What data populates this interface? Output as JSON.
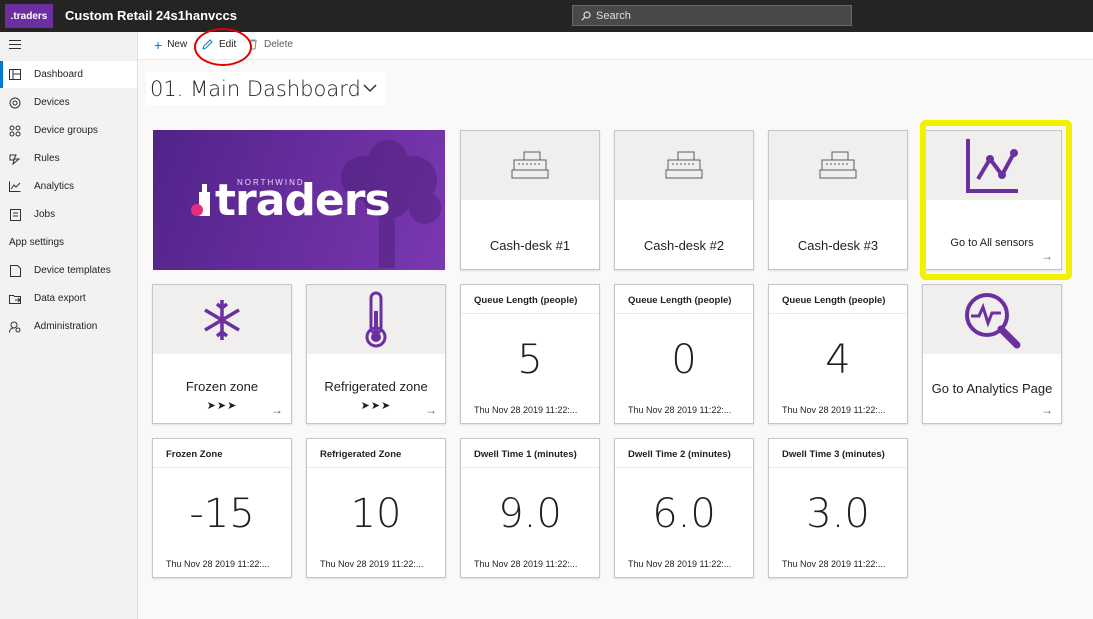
{
  "header": {
    "logo_text": ".traders",
    "app_title": "Custom Retail 24s1hanvccs",
    "search_placeholder": "Search"
  },
  "sidebar": {
    "items": [
      {
        "label": "Dashboard",
        "icon": "dashboard-icon",
        "active": true
      },
      {
        "label": "Devices",
        "icon": "devices-icon"
      },
      {
        "label": "Device groups",
        "icon": "device-groups-icon"
      },
      {
        "label": "Rules",
        "icon": "rules-icon"
      },
      {
        "label": "Analytics",
        "icon": "analytics-icon"
      },
      {
        "label": "Jobs",
        "icon": "jobs-icon"
      }
    ],
    "section_header": "App settings",
    "settings_items": [
      {
        "label": "Device templates",
        "icon": "device-templates-icon"
      },
      {
        "label": "Data export",
        "icon": "data-export-icon"
      },
      {
        "label": "Administration",
        "icon": "administration-icon"
      }
    ]
  },
  "commands": {
    "new_label": "New",
    "edit_label": "Edit",
    "delete_label": "Delete"
  },
  "dashboard": {
    "title": "01. Main Dashboard"
  },
  "banner": {
    "small_text": "NORTHWIND",
    "big_text": "traders"
  },
  "tiles": {
    "cash1": "Cash-desk #1",
    "cash2": "Cash-desk #2",
    "cash3": "Cash-desk #3",
    "sensors": "Go to All sensors",
    "frozen": "Frozen zone",
    "refrigerated": "Refrigerated zone",
    "analytics": "Go to Analytics Page",
    "chevrons": "➤➤➤"
  },
  "kpis": {
    "q1": {
      "title": "Queue Length (people)",
      "value": "5",
      "time": "Thu Nov 28 2019 11:22:..."
    },
    "q2": {
      "title": "Queue Length (people)",
      "value": "0",
      "time": "Thu Nov 28 2019 11:22:..."
    },
    "q3": {
      "title": "Queue Length (people)",
      "value": "4",
      "time": "Thu Nov 28 2019 11:22:..."
    },
    "fz": {
      "title": "Frozen Zone",
      "value": "-15",
      "time": "Thu Nov 28 2019 11:22:..."
    },
    "rz": {
      "title": "Refrigerated Zone",
      "value": "10",
      "time": "Thu Nov 28 2019 11:22:..."
    },
    "d1": {
      "title": "Dwell Time 1 (minutes)",
      "value": "9.0",
      "time": "Thu Nov 28 2019 11:22:..."
    },
    "d2": {
      "title": "Dwell Time 2 (minutes)",
      "value": "6.0",
      "time": "Thu Nov 28 2019 11:22:..."
    },
    "d3": {
      "title": "Dwell Time 3 (minutes)",
      "value": "3.0",
      "time": "Thu Nov 28 2019 11:22:..."
    }
  },
  "colors": {
    "brand_purple": "#6b2fa0",
    "accent_blue": "#0078d4",
    "annotation_red": "#e00000",
    "annotation_yellow": "#f2f200"
  }
}
